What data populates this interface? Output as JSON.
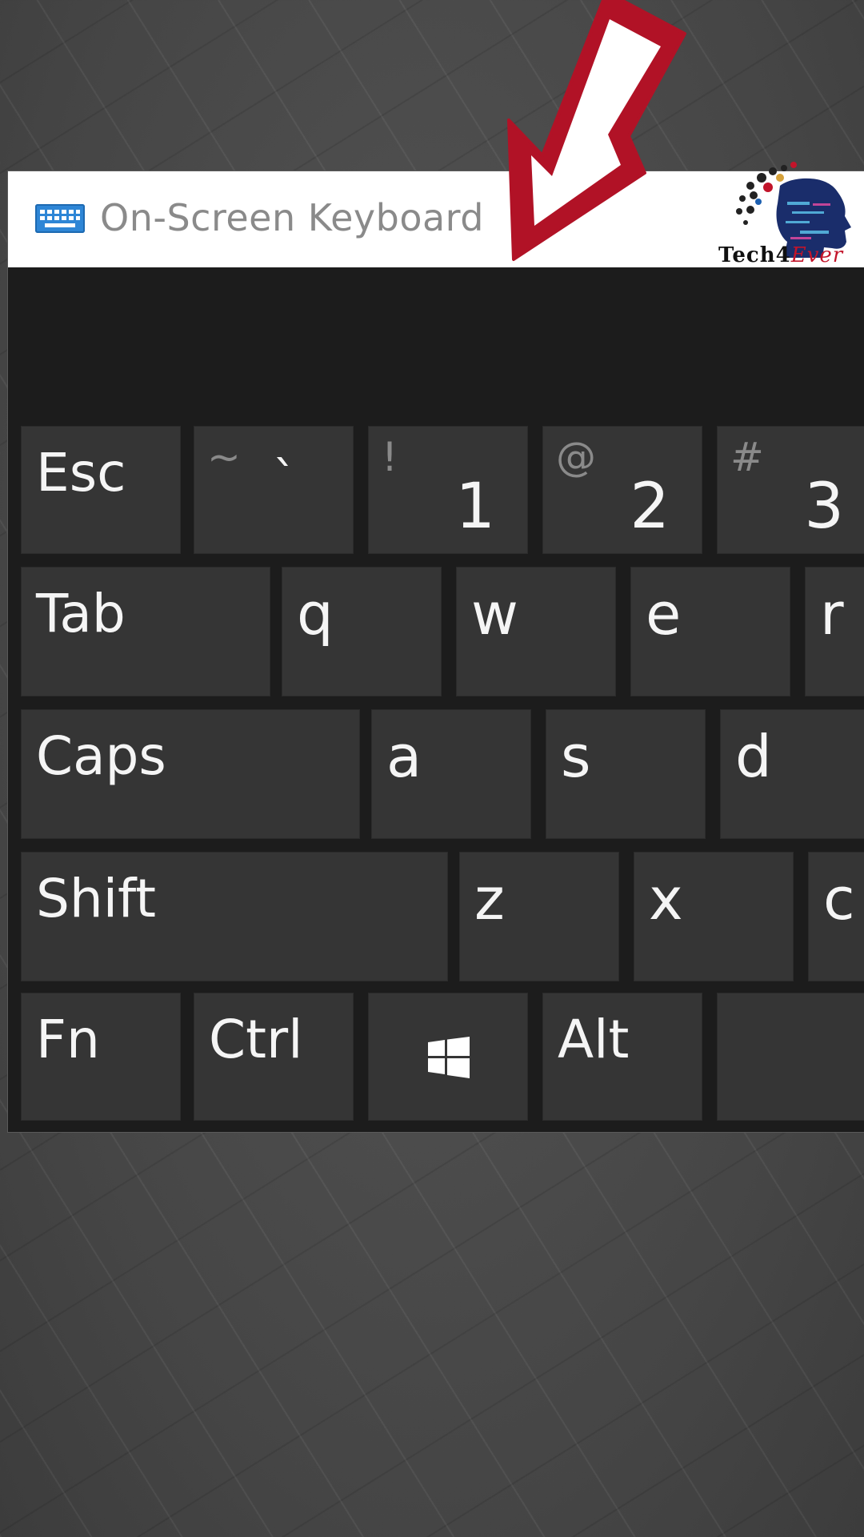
{
  "window": {
    "title": "On-Screen Keyboard",
    "title_icon": "keyboard-icon"
  },
  "logo": {
    "part1": "Tech4",
    "part2": "Ever"
  },
  "keyboard": {
    "row1": {
      "esc": "Esc",
      "backtick": {
        "shift": "~",
        "main": "`"
      },
      "one": {
        "shift": "!",
        "main": "1"
      },
      "two": {
        "shift": "@",
        "main": "2"
      },
      "three": {
        "shift": "#",
        "main": "3"
      }
    },
    "row2": {
      "tab": "Tab",
      "q": "q",
      "w": "w",
      "e": "e",
      "r": "r"
    },
    "row3": {
      "caps": "Caps",
      "a": "a",
      "s": "s",
      "d": "d"
    },
    "row4": {
      "shift": "Shift",
      "z": "z",
      "x": "x",
      "c": "c"
    },
    "row5": {
      "fn": "Fn",
      "ctrl": "Ctrl",
      "win": "windows-logo-icon",
      "alt": "Alt"
    }
  },
  "colors": {
    "window_bg": "#1c1c1c",
    "key_bg": "#353535",
    "key_text": "#f5f5f5",
    "shift_char_text": "#8a8a8a",
    "title_bar_bg": "#ffffff",
    "title_text": "#8a8a8a",
    "arrow_red": "#b11226",
    "arrow_inner": "#ffffff",
    "desktop_bg": "#4b4b4b"
  }
}
